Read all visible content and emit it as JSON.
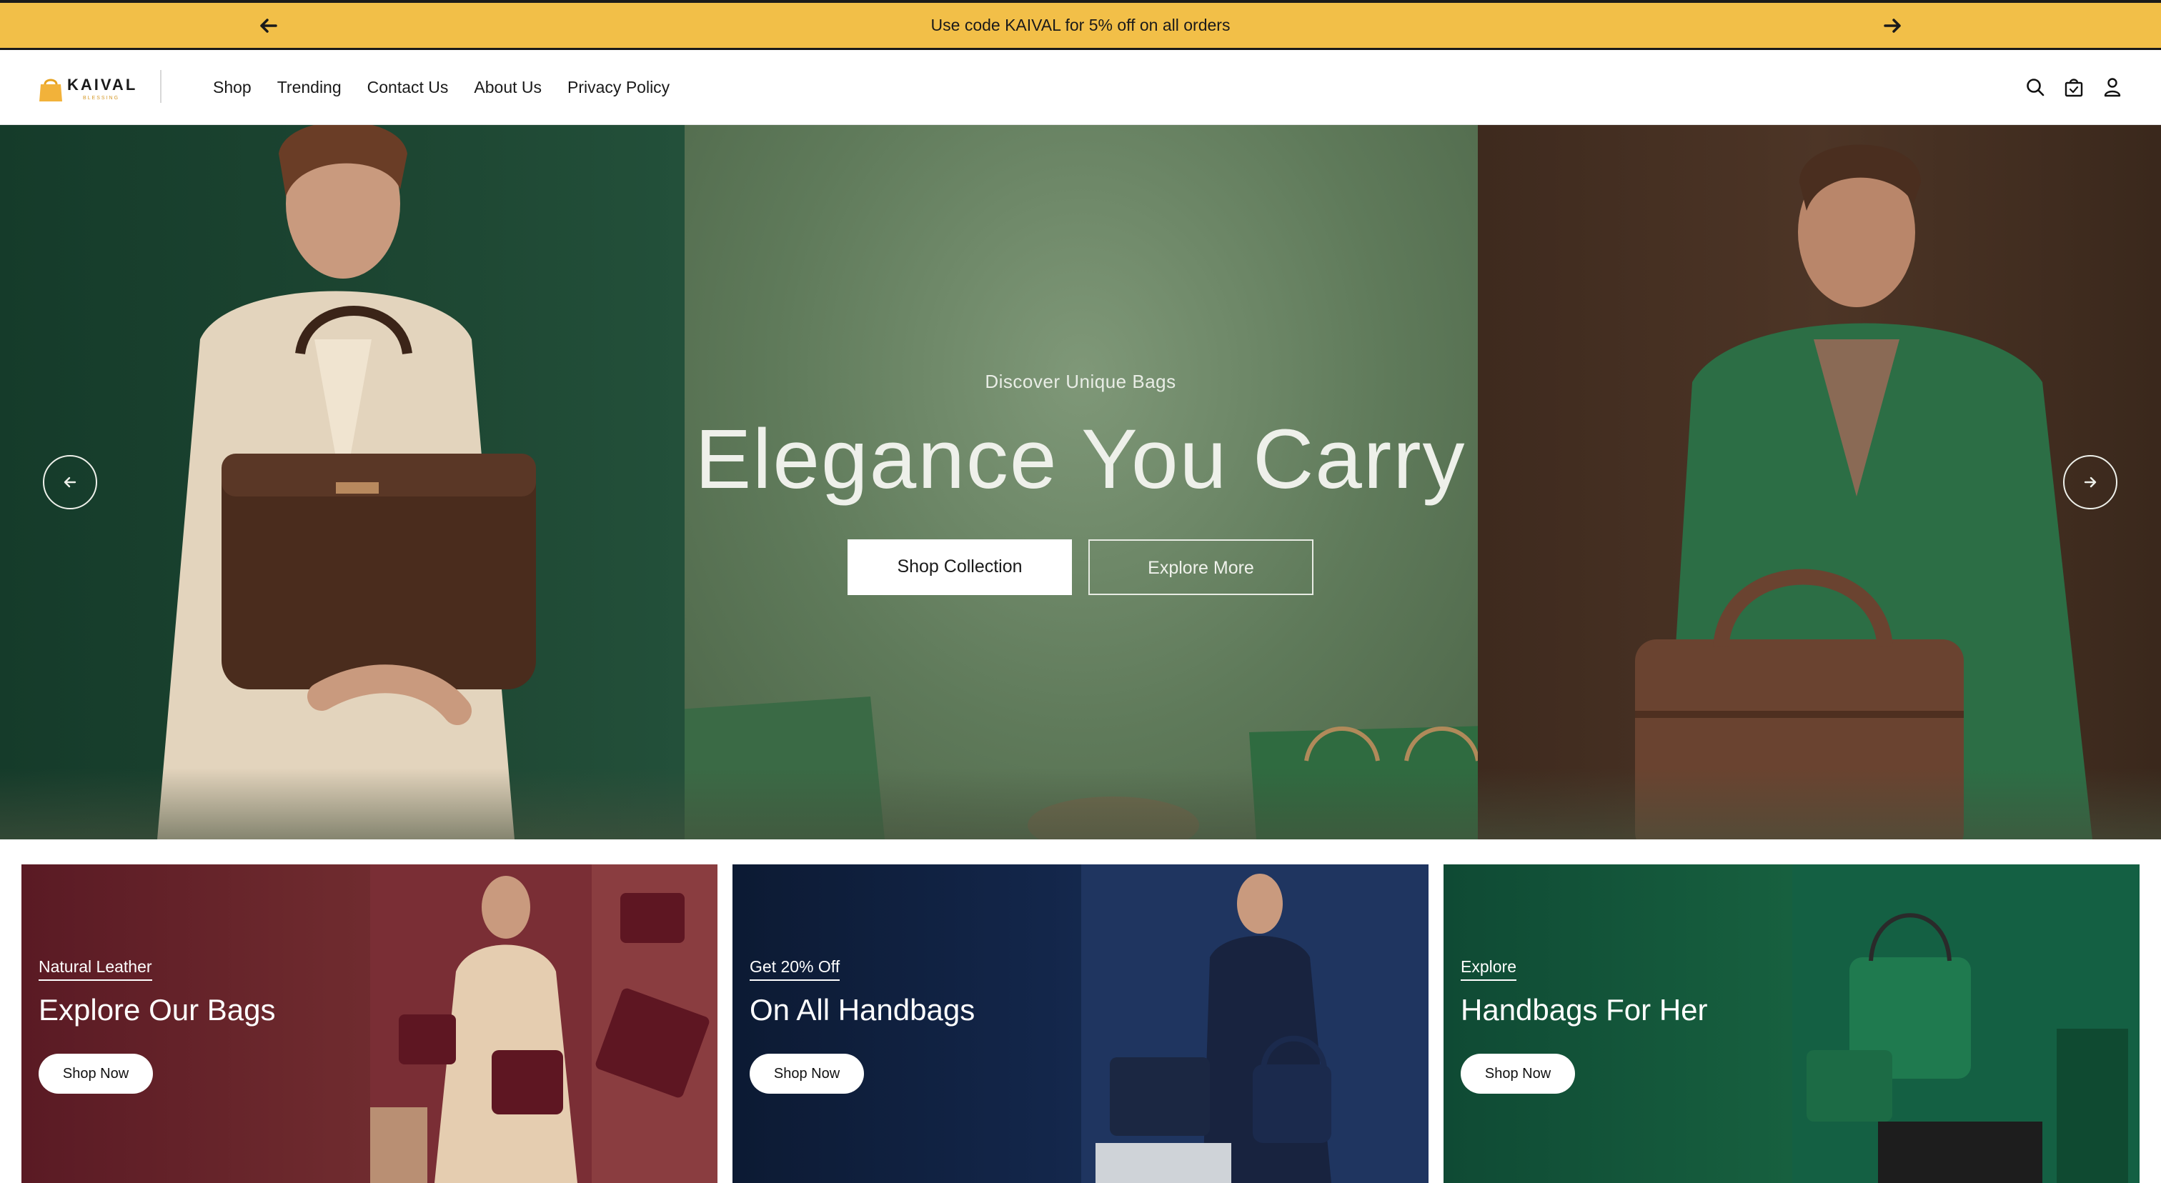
{
  "announcement": {
    "text": "Use code KAIVAL for 5% off on all orders",
    "prev_icon": "arrow-left-icon",
    "next_icon": "arrow-right-icon",
    "background": "#f2bf48"
  },
  "header": {
    "logo_text": "KAIVAL",
    "logo_subtext": "BLESSING",
    "logo_icon": "shopping-bag-icon",
    "nav": [
      "Shop",
      "Trending",
      "Contact Us",
      "About Us",
      "Privacy Policy"
    ],
    "icons": [
      "search-icon",
      "cart-icon",
      "user-icon"
    ]
  },
  "hero": {
    "kicker": "Discover Unique Bags",
    "title": "Elegance You Carry",
    "primary_button": "Shop Collection",
    "secondary_button": "Explore More",
    "prev_icon": "arrow-left-icon",
    "next_icon": "arrow-right-icon"
  },
  "cards": [
    {
      "kicker": "Natural Leather",
      "title": "Explore Our Bags",
      "button": "Shop Now",
      "color": "#6e2a2e"
    },
    {
      "kicker": "Get 20% Off",
      "title": "On All Handbags",
      "button": "Shop Now",
      "color": "#13264a"
    },
    {
      "kicker": "Explore",
      "title": "Handbags For Her",
      "button": "Shop Now",
      "color": "#17603f"
    }
  ]
}
